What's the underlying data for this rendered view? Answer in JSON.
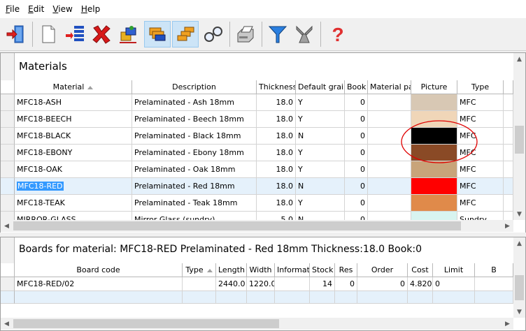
{
  "menu": {
    "file": {
      "u": "F",
      "rest": "ile"
    },
    "edit": {
      "u": "E",
      "rest": "dit"
    },
    "view": {
      "u": "V",
      "rest": "iew"
    },
    "help": {
      "u": "H",
      "rest": "elp"
    }
  },
  "toolbar_icons": [
    "exit-door-icon",
    "new-document-icon",
    "add-list-icon",
    "delete-x-icon",
    "exchange-icon",
    "materials-stack-icon",
    "boards-stack-icon",
    "search-glasses-icon",
    "print-icon",
    "filter-funnel-icon",
    "tools-icon",
    "help-question-icon"
  ],
  "materials": {
    "title": "Materials",
    "columns": [
      "Material",
      "Description",
      "Thickness",
      "Default grain",
      "Book",
      "Material par",
      "Picture",
      "Type"
    ],
    "rows": [
      {
        "material": "MFC18-ASH",
        "description": "Prelaminated - Ash 18mm",
        "thickness": "18.0",
        "grain": "Y",
        "book": "0",
        "picture_color": "#d8c8b4",
        "type": "MFC"
      },
      {
        "material": "MFC18-BEECH",
        "description": "Prelaminated - Beech 18mm",
        "thickness": "18.0",
        "grain": "Y",
        "book": "0",
        "picture_color": "#f0d6b8",
        "type": "MFC"
      },
      {
        "material": "MFC18-BLACK",
        "description": "Prelaminated - Black 18mm",
        "thickness": "18.0",
        "grain": "N",
        "book": "0",
        "picture_color": "#000000",
        "type": "MFC"
      },
      {
        "material": "MFC18-EBONY",
        "description": "Prelaminated - Ebony 18mm",
        "thickness": "18.0",
        "grain": "Y",
        "book": "0",
        "picture_color": "#8a4a26",
        "type": "MFC"
      },
      {
        "material": "MFC18-OAK",
        "description": "Prelaminated - Oak 18mm",
        "thickness": "18.0",
        "grain": "Y",
        "book": "0",
        "picture_color": "#c8a47a",
        "type": "MFC"
      },
      {
        "material": "MFC18-RED",
        "description": "Prelaminated - Red 18mm",
        "thickness": "18.0",
        "grain": "N",
        "book": "0",
        "picture_color": "#ff0000",
        "type": "MFC"
      },
      {
        "material": "MFC18-TEAK",
        "description": "Prelaminated - Teak 18mm",
        "thickness": "18.0",
        "grain": "Y",
        "book": "0",
        "picture_color": "#e08a4a",
        "type": "MFC"
      },
      {
        "material": "MIRROR-GLASS",
        "description": "Mirror Glass (sundry)",
        "thickness": "5.0",
        "grain": "N",
        "book": "0",
        "picture_color": "#d8f4f0",
        "type": "Sundry"
      }
    ]
  },
  "boards": {
    "title": "Boards for material: MFC18-RED Prelaminated - Red 18mm Thickness:18.0 Book:0",
    "columns": [
      "Board code",
      "Type",
      "Length",
      "Width",
      "Informati",
      "Stock",
      "Res",
      "Order",
      "Cost",
      "Limit",
      "B"
    ],
    "rows": [
      {
        "code": "MFC18-RED/02",
        "type": "",
        "length": "2440.0",
        "width": "1220.0",
        "info": "",
        "stock": "14",
        "res": "0",
        "order": "0",
        "cost": "4.820",
        "limit": "0",
        "b": ""
      }
    ]
  },
  "annotation_color": "#e00000"
}
